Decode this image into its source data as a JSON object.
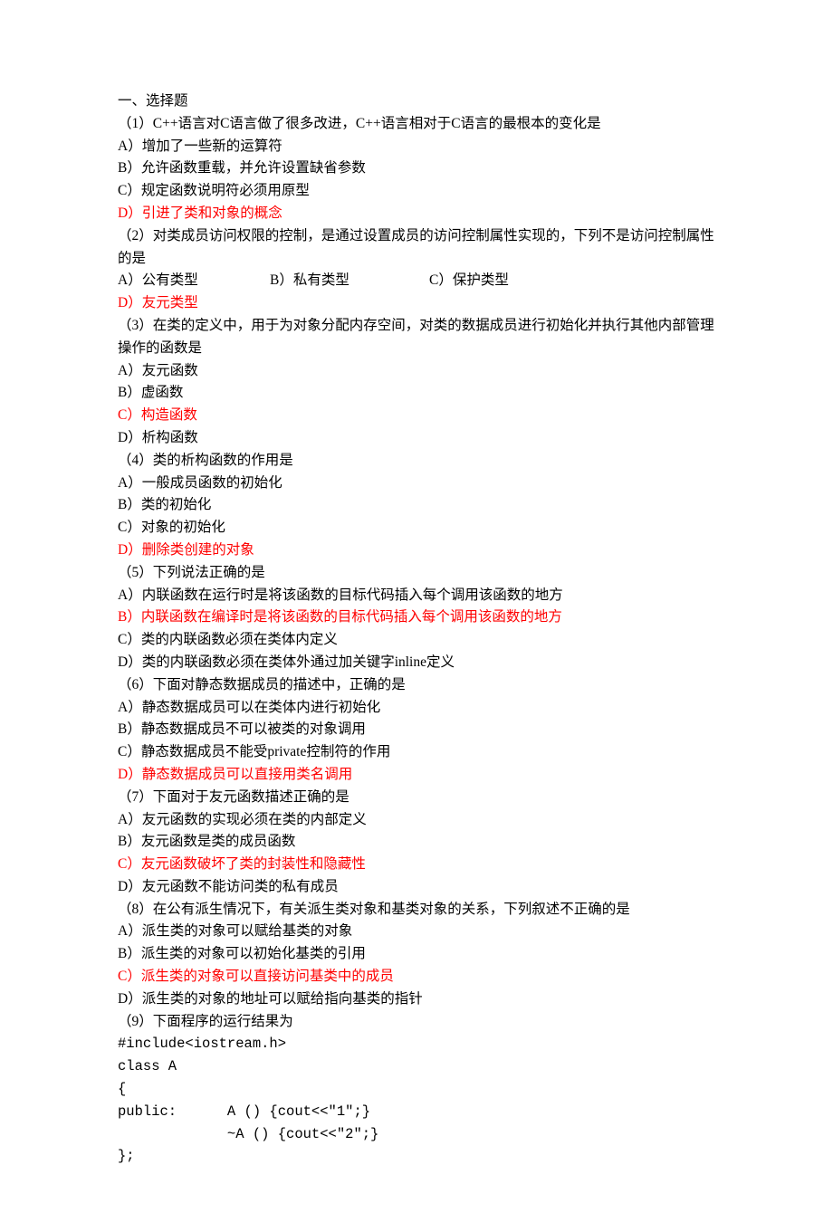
{
  "section_title": "一、选择题",
  "q1": {
    "stem": "（1）C++语言对C语言做了很多改进，C++语言相对于C语言的最根本的变化是",
    "a": "A）增加了一些新的运算符",
    "b": "B）允许函数重载，并允许设置缺省参数",
    "c": "C）规定函数说明符必须用原型",
    "d": "D）引进了类和对象的概念"
  },
  "q2": {
    "stem": "（2）对类成员访问权限的控制，是通过设置成员的访问控制属性实现的，下列不是访问控制属性的是",
    "a": "A）公有类型",
    "b": "B）私有类型",
    "c": "C）保护类型",
    "d": "D）友元类型"
  },
  "q3": {
    "stem": "（3）在类的定义中，用于为对象分配内存空间，对类的数据成员进行初始化并执行其他内部管理操作的函数是",
    "a": "A）友元函数",
    "b": "B）虚函数",
    "c": "C）构造函数",
    "d": "D）析构函数"
  },
  "q4": {
    "stem": "（4）类的析构函数的作用是",
    "a": "A）一般成员函数的初始化",
    "b": "B）类的初始化",
    "c": "C）对象的初始化",
    "d": "D）删除类创建的对象"
  },
  "q5": {
    "stem": "（5）下列说法正确的是",
    "a": "A）内联函数在运行时是将该函数的目标代码插入每个调用该函数的地方",
    "b": "B）内联函数在编译时是将该函数的目标代码插入每个调用该函数的地方",
    "c": "C）类的内联函数必须在类体内定义",
    "d": "D）类的内联函数必须在类体外通过加关键字inline定义"
  },
  "q6": {
    "stem": "（6）下面对静态数据成员的描述中，正确的是",
    "a": "A）静态数据成员可以在类体内进行初始化",
    "b": "B）静态数据成员不可以被类的对象调用",
    "c": "C）静态数据成员不能受private控制符的作用",
    "d": "D）静态数据成员可以直接用类名调用"
  },
  "q7": {
    "stem": "（7）下面对于友元函数描述正确的是",
    "a": "A）友元函数的实现必须在类的内部定义",
    "b": "B）友元函数是类的成员函数",
    "c": "C）友元函数破坏了类的封装性和隐藏性",
    "d": "D）友元函数不能访问类的私有成员"
  },
  "q8": {
    "stem": "（8）在公有派生情况下，有关派生类对象和基类对象的关系，下列叙述不正确的是",
    "a": "A）派生类的对象可以赋给基类的对象",
    "b": "B）派生类的对象可以初始化基类的引用",
    "c": "C）派生类的对象可以直接访问基类中的成员",
    "d": "D）派生类的对象的地址可以赋给指向基类的指针"
  },
  "q9": {
    "stem": "（9）下面程序的运行结果为",
    "code1": "#include<iostream.h>",
    "code2": "class A",
    "code3": "{",
    "code4": "public:      A () {cout<<″1″;}",
    "code5": "             ~A () {cout<<″2″;}",
    "code6": "};"
  }
}
